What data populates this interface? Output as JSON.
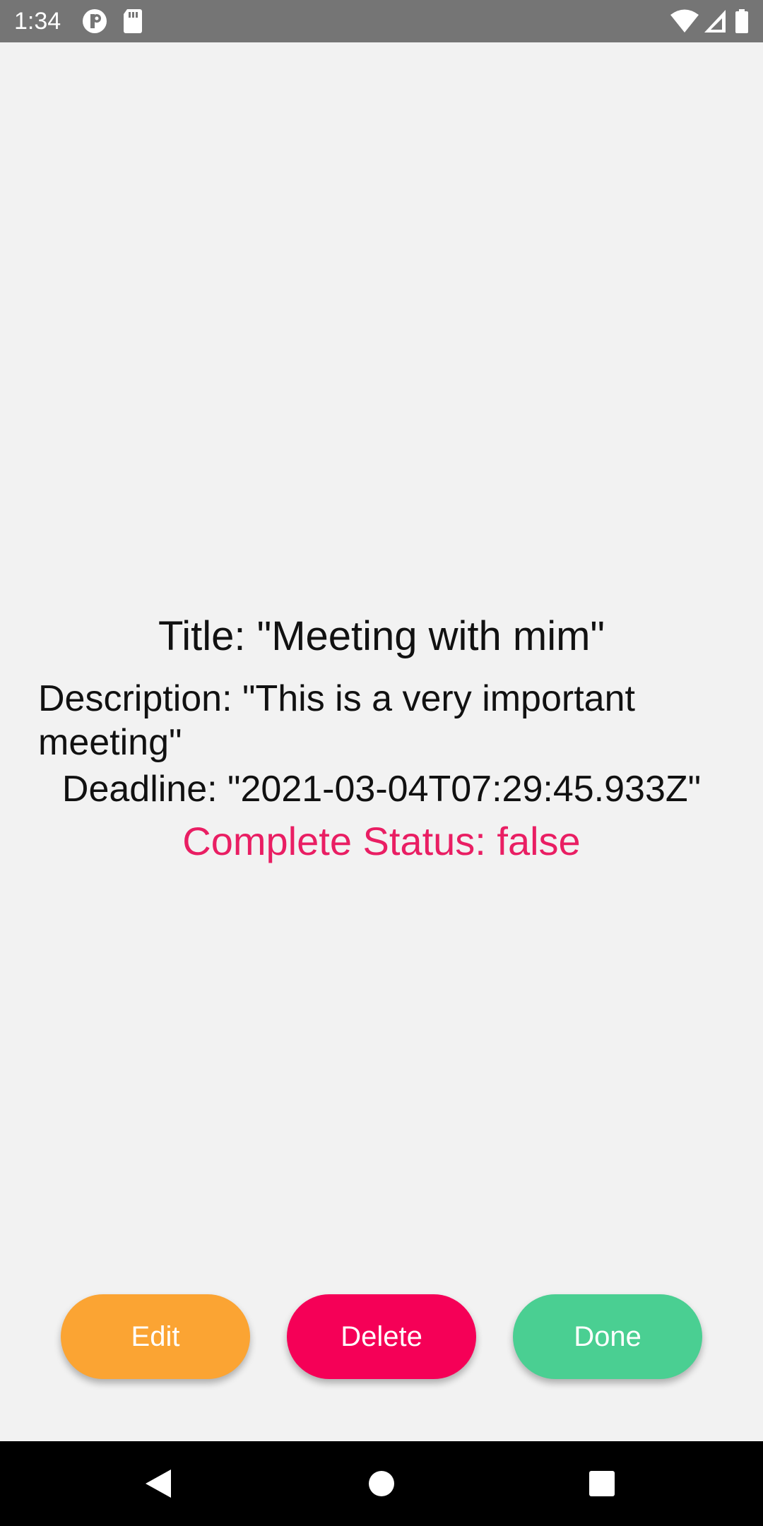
{
  "status_bar": {
    "time": "1:34",
    "icons": [
      "notification-icon",
      "sd-card-icon",
      "wifi-icon",
      "cell-signal-icon",
      "battery-icon"
    ]
  },
  "task": {
    "title": "Title: \"Meeting with mim\"",
    "description": "Description: \"This is a very important meeting\"",
    "deadline": "Deadline: \"2021-03-04T07:29:45.933Z\"",
    "complete_status": "Complete Status: false"
  },
  "actions": {
    "edit_label": "Edit",
    "delete_label": "Delete",
    "done_label": "Done"
  },
  "colors": {
    "edit": "#fba433",
    "delete": "#f50057",
    "done": "#4acf92",
    "status_text": "#e91e63"
  },
  "nav_bar": {
    "buttons": [
      "back-icon",
      "home-icon",
      "recents-icon"
    ]
  }
}
